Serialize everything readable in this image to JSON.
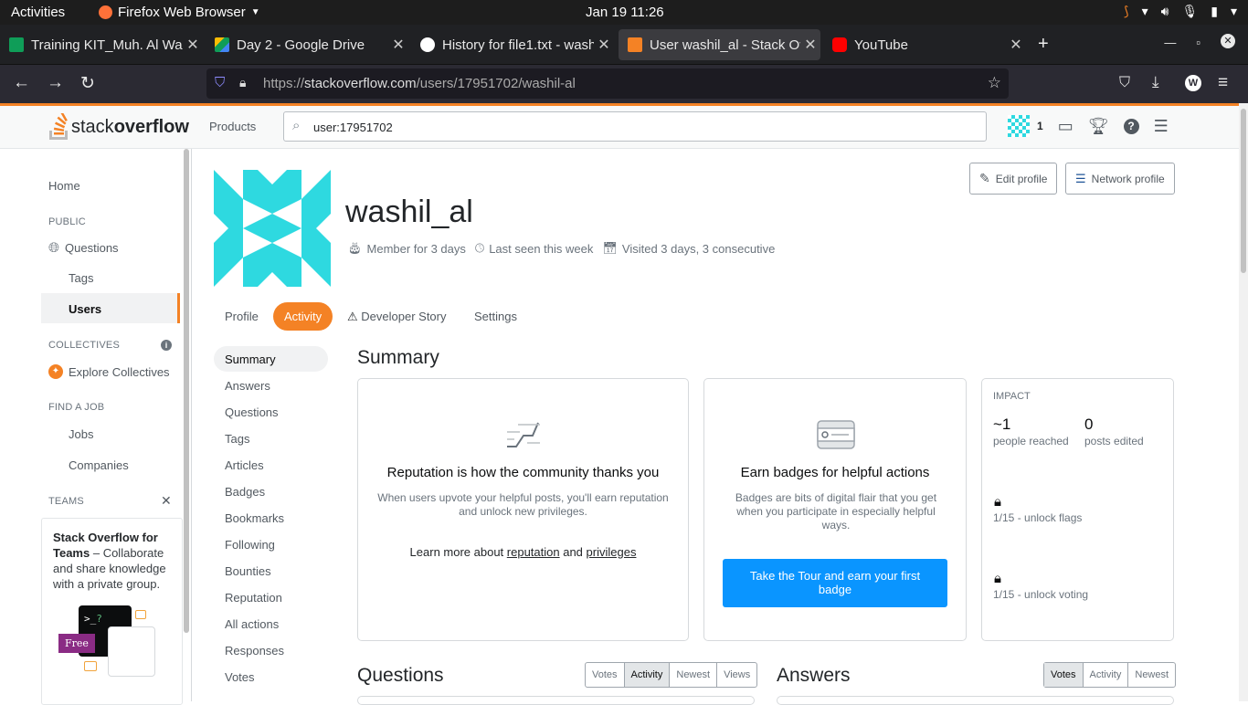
{
  "os": {
    "activities": "Activities",
    "app_name": "Firefox Web Browser",
    "clock": "Jan 19  11:26"
  },
  "tabs": [
    {
      "title": "Training KIT_Muh. Al Was",
      "favicon_color": "#0f9d58"
    },
    {
      "title": "Day 2 - Google Drive",
      "favicon_color": "#fbbc04"
    },
    {
      "title": "History for file1.txt - wash",
      "favicon_color": "#ffffff"
    },
    {
      "title": "User washil_al - Stack Ove",
      "favicon_color": "#f48225",
      "active": true
    },
    {
      "title": "YouTube",
      "favicon_color": "#ff0000"
    }
  ],
  "browser": {
    "url_scheme": "https://",
    "url_host": "stackoverflow.com",
    "url_path": "/users/17951702/washil-al"
  },
  "so_header": {
    "logo_light": "stack",
    "logo_bold": "overflow",
    "products": "Products",
    "search_value": "user:17951702",
    "reputation": "1"
  },
  "leftnav": {
    "home": "Home",
    "public": "PUBLIC",
    "questions": "Questions",
    "tags": "Tags",
    "users": "Users",
    "collectives": "COLLECTIVES",
    "explore_collectives": "Explore Collectives",
    "find_a_job": "FIND A JOB",
    "jobs": "Jobs",
    "companies": "Companies",
    "teams": "TEAMS",
    "teams_title": "Stack Overflow for Teams",
    "teams_desc": " – Collaborate and share knowledge with a private group.",
    "free_badge": "Free"
  },
  "profile": {
    "username": "washil_al",
    "member_for": "Member for 3 days",
    "last_seen": "Last seen this week",
    "visited": "Visited 3 days, 3 consecutive",
    "edit_profile": "Edit profile",
    "network_profile": "Network profile",
    "tabs": [
      "Profile",
      "Activity",
      "Developer Story",
      "Settings"
    ]
  },
  "activity_menu": [
    "Summary",
    "Answers",
    "Questions",
    "Tags",
    "Articles",
    "Badges",
    "Bookmarks",
    "Following",
    "Bounties",
    "Reputation",
    "All actions",
    "Responses",
    "Votes"
  ],
  "summary": {
    "heading": "Summary",
    "rep_title": "Reputation is how the community thanks you",
    "rep_desc": "When users upvote your helpful posts, you'll earn reputation and unlock new privileges.",
    "learn_prefix": "Learn more about ",
    "learn_link1": "reputation",
    "learn_and": " and ",
    "learn_link2": "privileges",
    "badge_title": "Earn badges for helpful actions",
    "badge_desc": "Badges are bits of digital flair that you get when you participate in especially helpful ways.",
    "tour_button": "Take the Tour and earn your first badge",
    "impact_label": "IMPACT",
    "people_value": "~1",
    "people_label": "people reached",
    "posts_value": "0",
    "posts_label": "posts edited",
    "unlock_flags": "1/15 - unlock flags",
    "unlock_voting": "1/15 - unlock voting"
  },
  "questions": {
    "heading": "Questions",
    "sort": [
      "Votes",
      "Activity",
      "Newest",
      "Views"
    ],
    "selected": "Activity"
  },
  "answers": {
    "heading": "Answers",
    "sort": [
      "Votes",
      "Activity",
      "Newest"
    ],
    "selected": "Votes"
  }
}
